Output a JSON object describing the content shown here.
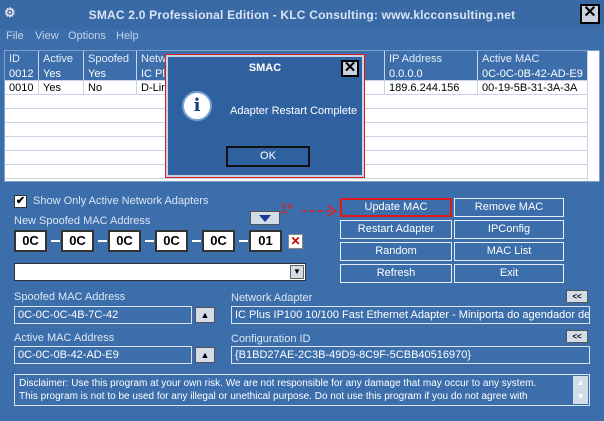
{
  "title": "SMAC 2.0  Professional Edition  -  KLC Consulting:  www.klcconsulting.net",
  "menu": [
    "File",
    "View",
    "Options",
    "Help"
  ],
  "table": {
    "headers": [
      "ID",
      "Active",
      "Spoofed",
      "Netw",
      "IP Address",
      "Active MAC"
    ],
    "rows": [
      [
        "0012",
        "Yes",
        "Yes",
        "IC Plu",
        "0.0.0.0",
        "0C-0C-0B-42-AD-E9"
      ],
      [
        "0010",
        "Yes",
        "No",
        "D-Lin",
        "189.6.244.156",
        "00-19-5B-31-3A-3A"
      ]
    ]
  },
  "options": {
    "show_active_label": "Show Only Active Network Adapters",
    "show_active_checked": "✔"
  },
  "new_mac": {
    "label": "New Spoofed MAC Address",
    "octets": [
      "0C",
      "0C",
      "0C",
      "0C",
      "0C",
      "01"
    ]
  },
  "annotation": "1º",
  "buttons": {
    "update_mac": "Update MAC",
    "remove_mac": "Remove MAC",
    "restart_adapter": "Restart Adapter",
    "ipconfig": "IPConfig",
    "random": "Random",
    "mac_list": "MAC List",
    "refresh": "Refresh",
    "exit": "Exit"
  },
  "spoofed": {
    "label": "Spoofed MAC Address",
    "value": "0C-0C-0C-4B-7C-42"
  },
  "active": {
    "label": "Active MAC Address",
    "value": "0C-0C-0B-42-AD-E9"
  },
  "adapter": {
    "label": "Network Adapter",
    "value": "IC Plus IP100 10/100 Fast Ethernet Adapter - Miniporta do agendador de"
  },
  "config": {
    "label": "Configuration ID",
    "value": "{B1BD27AE-2C3B-49D9-8C9F-5CBB40516970}"
  },
  "disclaimer": {
    "line1": "Disclaimer: Use this program at your own risk.  We are not responsible for any damage that may occur to any system.",
    "line2": "This program is not to be used for any illegal or unethical purpose.  Do not use this program if you do not agree with"
  },
  "dialog": {
    "title": "SMAC",
    "message": "Adapter Restart Complete",
    "ok": "OK"
  }
}
